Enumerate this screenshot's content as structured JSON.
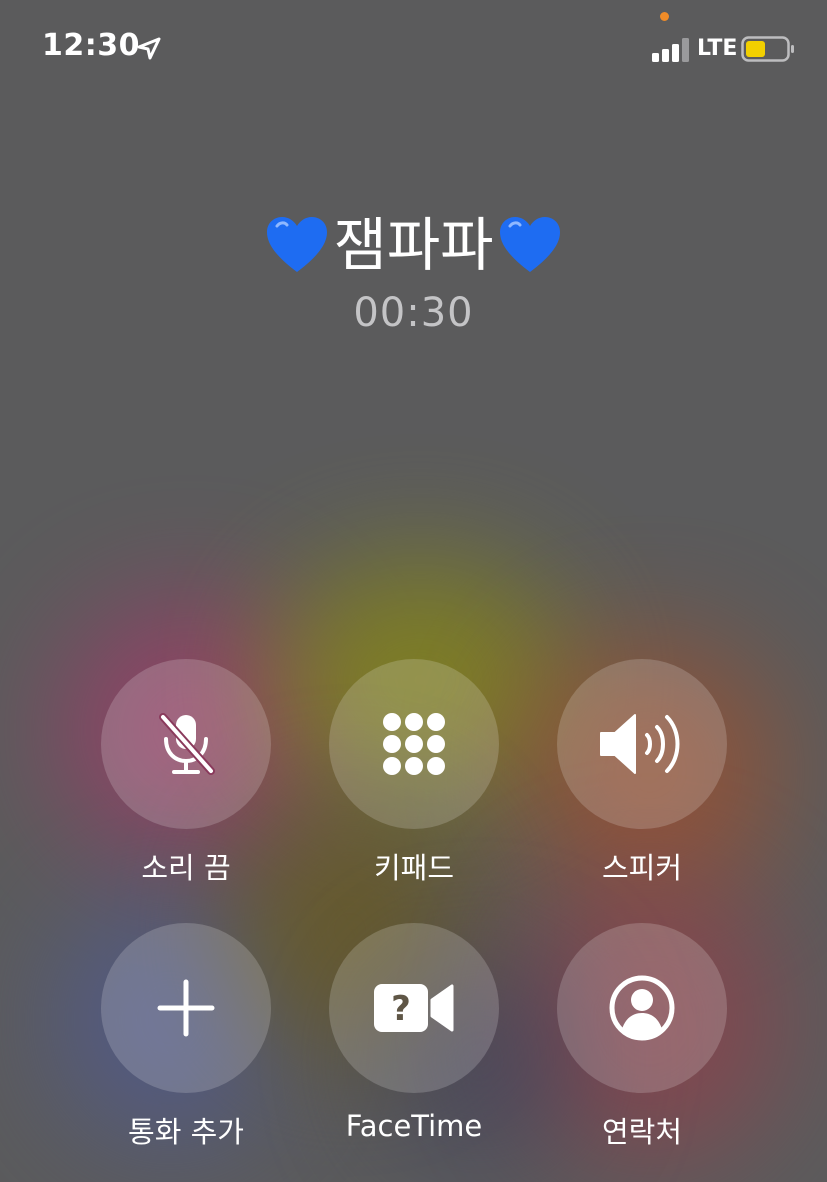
{
  "status_bar": {
    "time": "12:30",
    "network": "LTE",
    "location_icon": "location-arrow-icon",
    "signal_icon": "cellular-signal-icon",
    "battery_icon": "battery-icon",
    "battery_color": "#f2d000",
    "mic_indicator_color": "#f08c28"
  },
  "call": {
    "contact_name": "잼파파",
    "heart_emoji": "blue-heart-icon",
    "heart_color": "#1e6cf2",
    "duration": "00:30"
  },
  "controls": [
    {
      "label": "소리 끔",
      "icon": "mute-microphone-icon"
    },
    {
      "label": "키패드",
      "icon": "keypad-icon"
    },
    {
      "label": "스피커",
      "icon": "speaker-icon"
    },
    {
      "label": "통화 추가",
      "icon": "plus-icon"
    },
    {
      "label": "FaceTime",
      "icon": "facetime-video-icon"
    },
    {
      "label": "연락처",
      "icon": "contact-icon"
    }
  ]
}
